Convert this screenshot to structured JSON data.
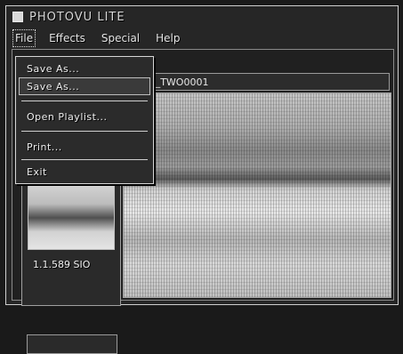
{
  "window": {
    "title": "PHOTOVU LITE"
  },
  "menubar": {
    "items": [
      "File",
      "Effects",
      "Special",
      "Help"
    ]
  },
  "path": {
    "value": "\\_TWO0001"
  },
  "thumbnail": {
    "label": "1.1.589 SIO"
  },
  "file_menu": {
    "items": [
      "Save As...",
      "Save As...",
      "Open Playlist...",
      "Print...",
      "Exit"
    ],
    "selected_index": 1
  },
  "colors": {
    "text": "#e6e6e6",
    "border": "#cfcfcf",
    "background": "#1d1d1d"
  }
}
